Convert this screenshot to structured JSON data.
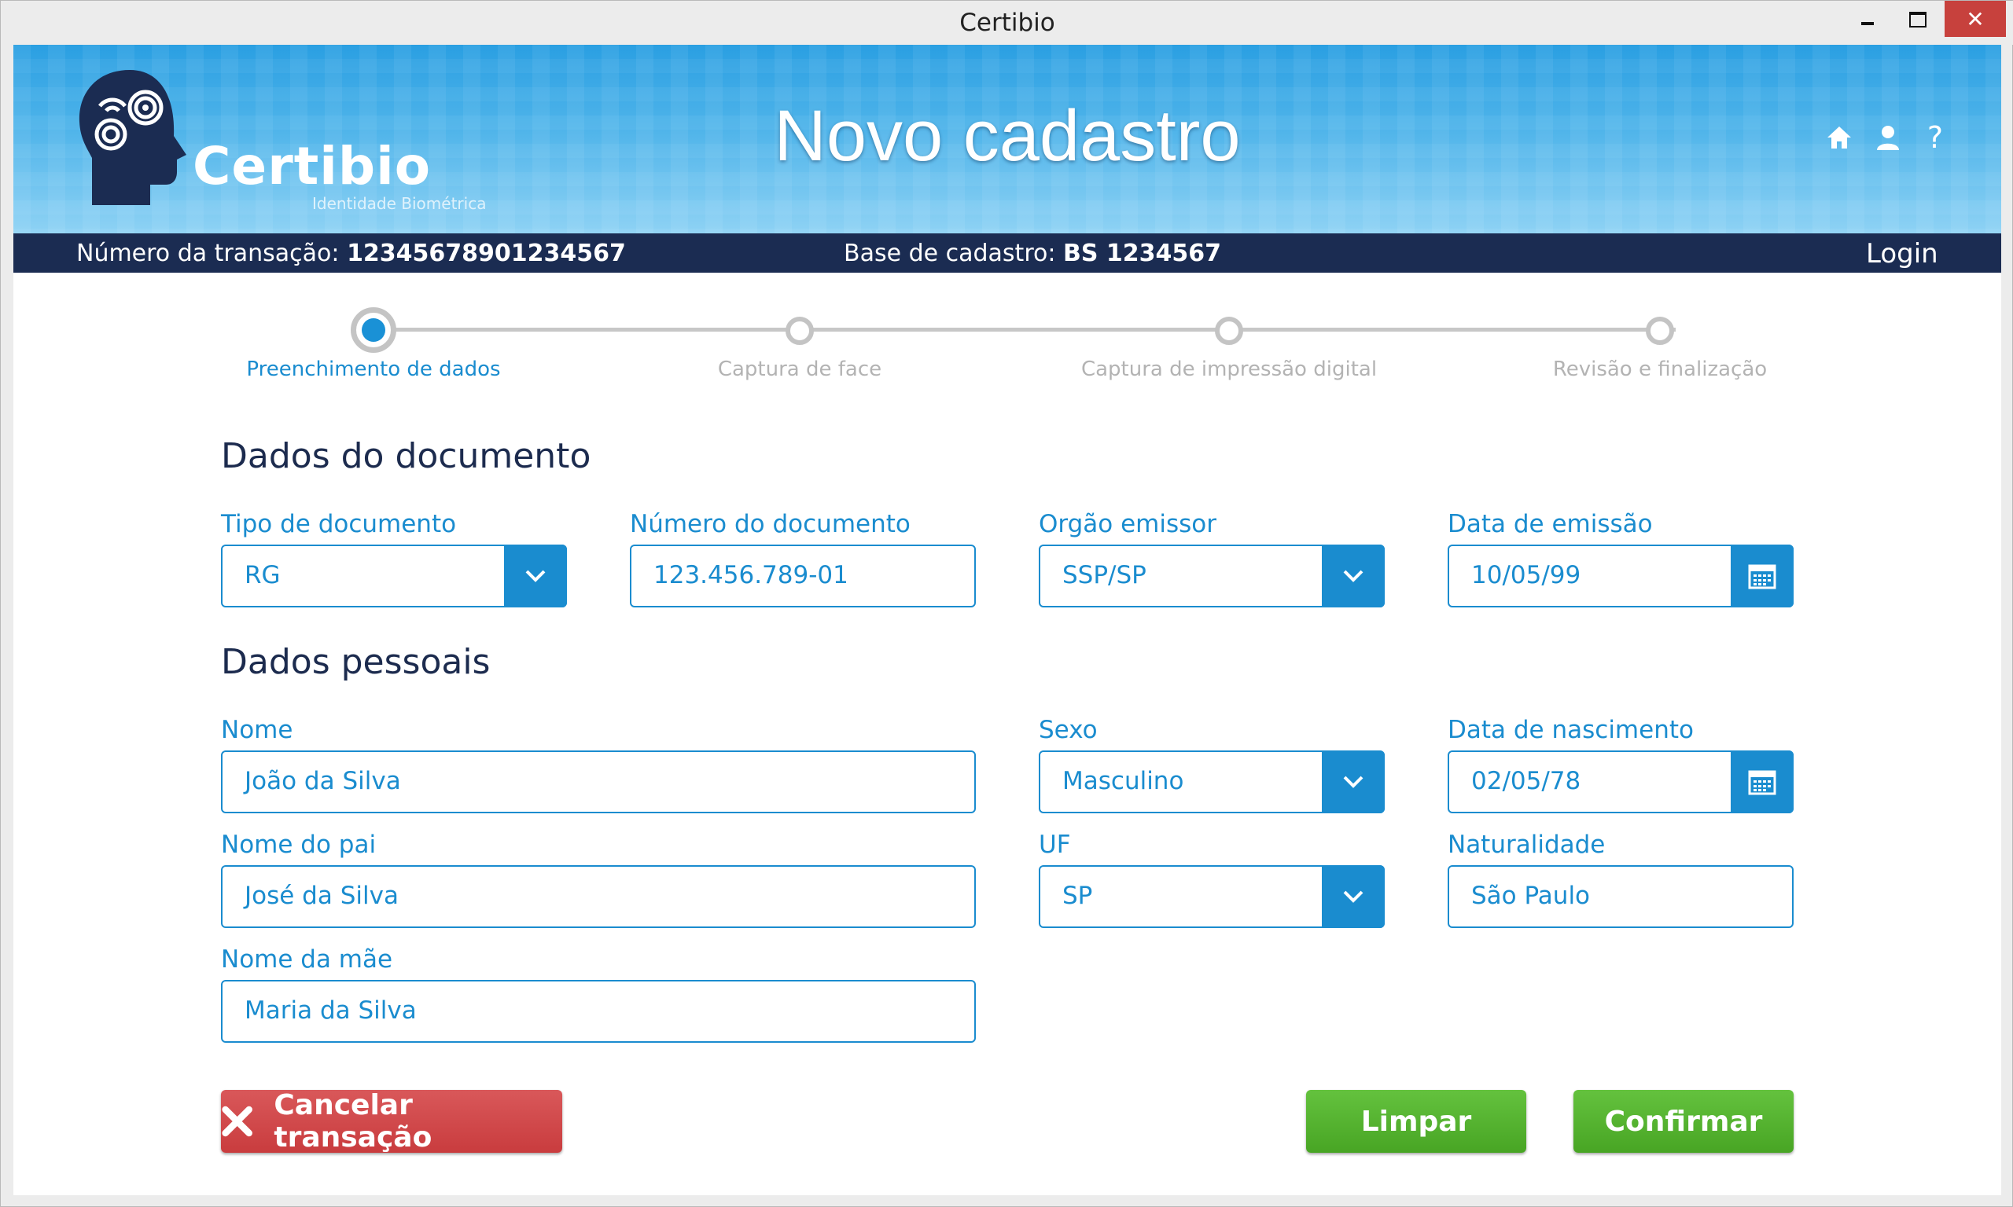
{
  "window": {
    "title": "Certibio"
  },
  "brand": {
    "name": "Certibio",
    "tagline": "Identidade Biométrica"
  },
  "header": {
    "title": "Novo cadastro",
    "help_label": "?"
  },
  "infobar": {
    "transaction_label": "Número da transação:",
    "transaction_value": "12345678901234567",
    "base_label": "Base de cadastro:",
    "base_value": "BS 1234567",
    "login_label": "Login"
  },
  "steps": [
    {
      "label": "Preenchimento de dados",
      "active": true
    },
    {
      "label": "Captura de face",
      "active": false
    },
    {
      "label": "Captura de impressão digital",
      "active": false
    },
    {
      "label": "Revisão e finalização",
      "active": false
    }
  ],
  "document": {
    "title": "Dados do documento",
    "tipo": {
      "label": "Tipo de documento",
      "value": "RG"
    },
    "numero": {
      "label": "Número do documento",
      "value": "123.456.789-01"
    },
    "orgao": {
      "label": "Orgão emissor",
      "value": "SSP/SP"
    },
    "emissao": {
      "label": "Data de emissão",
      "value": "10/05/99"
    }
  },
  "personal": {
    "title": "Dados pessoais",
    "nome": {
      "label": "Nome",
      "value": "João da Silva"
    },
    "sexo": {
      "label": "Sexo",
      "value": "Masculino"
    },
    "nascimento": {
      "label": "Data de nascimento",
      "value": "02/05/78"
    },
    "pai": {
      "label": "Nome do pai",
      "value": "José da Silva"
    },
    "uf": {
      "label": "UF",
      "value": "SP"
    },
    "naturalidade": {
      "label": "Naturalidade",
      "value": "São Paulo"
    },
    "mae": {
      "label": "Nome da mãe",
      "value": "Maria da Silva"
    }
  },
  "actions": {
    "cancel": "Cancelar transação",
    "clear": "Limpar",
    "confirm": "Confirmar"
  },
  "colors": {
    "accent": "#1a8ccf",
    "navy": "#1b2c52",
    "danger": "#c93c3e",
    "success": "#48a524"
  }
}
